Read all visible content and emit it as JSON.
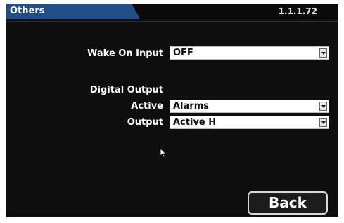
{
  "header": {
    "tab_title": "Others",
    "version": "1.1.1.72"
  },
  "form": {
    "wake_on_input": {
      "label": "Wake On Input",
      "value": "OFF"
    },
    "digital_output": {
      "section_label": "Digital Output",
      "active": {
        "label": "Active",
        "value": "Alarms"
      },
      "output": {
        "label": "Output",
        "value": "Active H"
      }
    }
  },
  "actions": {
    "back_label": "Back"
  },
  "colors": {
    "tab_blue": "#1f4f86",
    "background": "#0e0e0e"
  }
}
